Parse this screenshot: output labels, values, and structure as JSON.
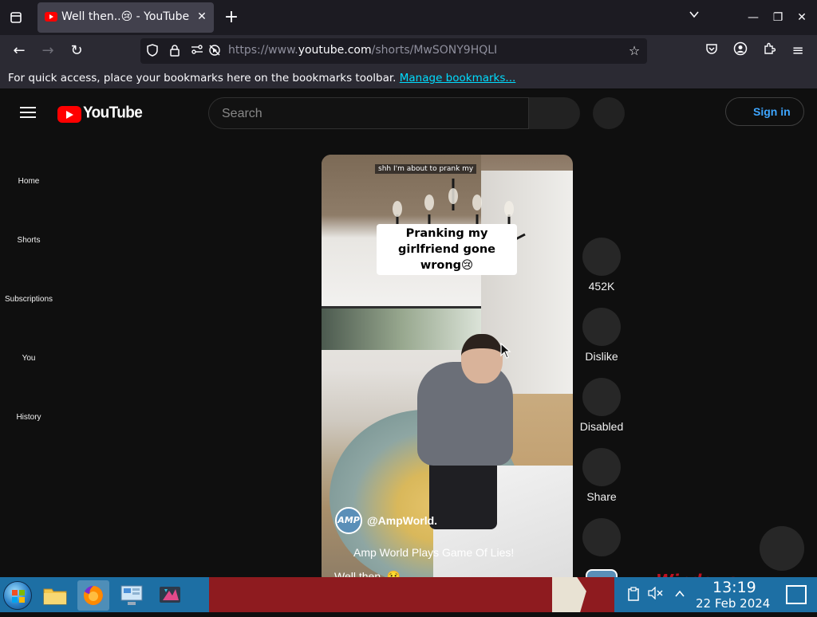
{
  "browser": {
    "tab_title": "Well then..😢 - YouTube",
    "url_prefix": "https://www.",
    "url_domain": "youtube.com",
    "url_path": "/shorts/MwSONY9HQLI",
    "bookmarks_message": "For quick access, place your bookmarks here on the bookmarks toolbar.",
    "manage_bookmarks_label": "Manage bookmarks..."
  },
  "youtube": {
    "logo_text": "YouTube",
    "search_placeholder": "Search",
    "sign_in_label": "Sign in",
    "sidebar": [
      {
        "label": "Home"
      },
      {
        "label": "Shorts"
      },
      {
        "label": "Subscriptions"
      },
      {
        "label": "You"
      },
      {
        "label": "History"
      }
    ],
    "short": {
      "overlay_caption": "shh I'm about to prank my",
      "title_caption": "Pranking my girlfriend gone wrong😢",
      "channel_name": "@AmpWorld.",
      "channel_avatar_text": "AMP",
      "description": "Amp World Plays Game Of Lies!",
      "description_2": "Well then..😢"
    },
    "actions": {
      "like_count": "452K",
      "dislike_label": "Dislike",
      "comments_label": "Disabled",
      "share_label": "Share"
    }
  },
  "taskbar": {
    "time": "13:19",
    "date": "22 Feb 2024",
    "wallpaper_text": "Windows"
  }
}
